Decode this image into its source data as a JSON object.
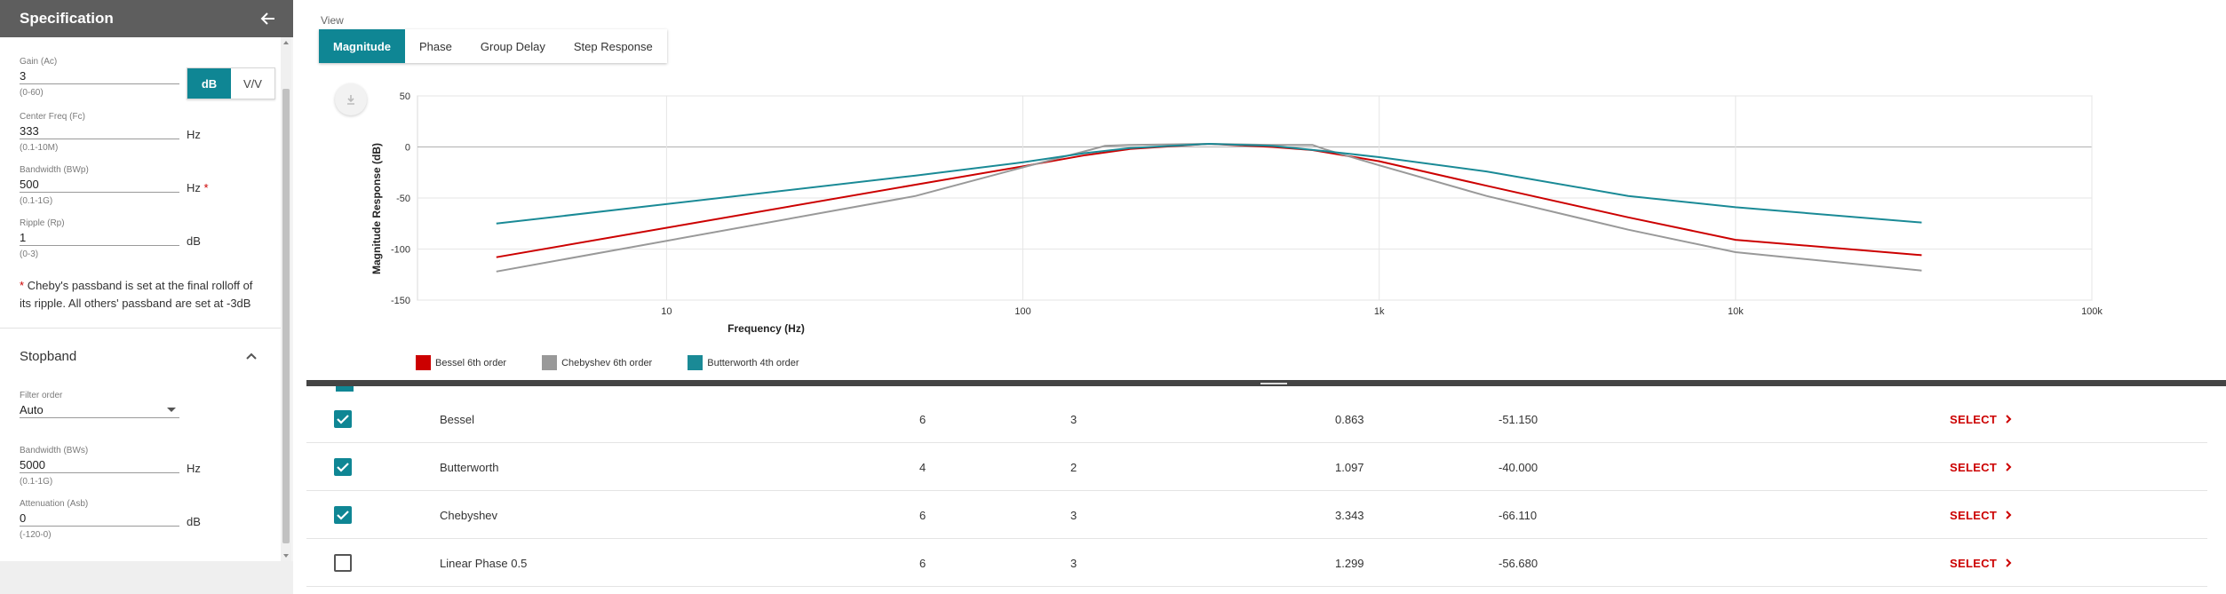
{
  "panel": {
    "title": "Specification"
  },
  "passband": {
    "gain": {
      "label": "Gain (Ac)",
      "value": "3",
      "hint": "(0-60)"
    },
    "unit_toggle": {
      "db_label": "dB",
      "vv_label": "V/V",
      "selected": "dB"
    },
    "center_freq": {
      "label": "Center Freq (Fc)",
      "value": "333",
      "hint": "(0.1-10M)",
      "unit": "Hz"
    },
    "bandwidth": {
      "label": "Bandwidth (BWp)",
      "value": "500",
      "hint": "(0.1-1G)",
      "unit": "Hz",
      "required_mark": "*"
    },
    "ripple": {
      "label": "Ripple (Rp)",
      "value": "1",
      "hint": "(0-3)",
      "unit": "dB"
    },
    "note_mark": "*",
    "note_text": "Cheby's passband is set at the final rolloff of its ripple. All others' passband are set at -3dB"
  },
  "stopband": {
    "title": "Stopband",
    "filter_order": {
      "label": "Filter order",
      "value": "Auto"
    },
    "bandwidth": {
      "label": "Bandwidth (BWs)",
      "value": "5000",
      "hint": "(0.1-1G)",
      "unit": "Hz"
    },
    "attenuation": {
      "label": "Attenuation (Asb)",
      "value": "0",
      "hint": "(-120-0)",
      "unit": "dB"
    }
  },
  "view": {
    "label": "View",
    "tabs": [
      "Magnitude",
      "Phase",
      "Group Delay",
      "Step Response"
    ],
    "active_tab": "Magnitude"
  },
  "chart_data": {
    "type": "line",
    "xlabel": "Frequency (Hz)",
    "ylabel": "Magnitude Response (dB)",
    "x_scale": "log",
    "xlim": [
      2,
      100000
    ],
    "ylim": [
      -150,
      50
    ],
    "x_ticks": [
      {
        "value": 10,
        "label": "10"
      },
      {
        "value": 100,
        "label": "100"
      },
      {
        "value": 1000,
        "label": "1k"
      },
      {
        "value": 10000,
        "label": "10k"
      },
      {
        "value": 100000,
        "label": "100k"
      }
    ],
    "y_ticks": [
      50,
      0,
      -50,
      -100,
      -150
    ],
    "grid": true,
    "legend_position": "bottom-left",
    "series": [
      {
        "name": "Bessel 6th order",
        "color": "#cc0000",
        "x": [
          3.33,
          50,
          100,
          150,
          200,
          333,
          500,
          650,
          1000,
          2000,
          5000,
          10000,
          33300
        ],
        "y": [
          -108,
          -37,
          -19,
          -8,
          -2,
          3,
          0,
          -3,
          -14,
          -38,
          -69,
          -91,
          -106
        ]
      },
      {
        "name": "Chebyshev 6th order",
        "color": "#999999",
        "x": [
          3.33,
          50,
          100,
          150,
          170,
          200,
          333,
          500,
          650,
          700,
          1000,
          2000,
          5000,
          10000,
          33300
        ],
        "y": [
          -122,
          -48,
          -20,
          -4,
          1,
          2,
          3,
          2,
          2,
          -2,
          -18,
          -48,
          -81,
          -103,
          -121
        ]
      },
      {
        "name": "Butterworth 4th order",
        "color": "#1a8a96",
        "x": [
          3.33,
          50,
          100,
          150,
          200,
          333,
          500,
          700,
          1000,
          2000,
          5000,
          10000,
          33300
        ],
        "y": [
          -75,
          -28,
          -15,
          -6,
          -1,
          3,
          1,
          -4,
          -10,
          -24,
          -48,
          -59,
          -74
        ]
      }
    ]
  },
  "table": {
    "select_label": "SELECT",
    "rows": [
      {
        "checked": true,
        "name": "Bessel",
        "order": "6",
        "stages": "3",
        "q": "0.863",
        "atten": "-51.150"
      },
      {
        "checked": true,
        "name": "Butterworth",
        "order": "4",
        "stages": "2",
        "q": "1.097",
        "atten": "-40.000"
      },
      {
        "checked": true,
        "name": "Chebyshev",
        "order": "6",
        "stages": "3",
        "q": "3.343",
        "atten": "-66.110"
      },
      {
        "checked": false,
        "name": "Linear Phase 0.5",
        "order": "6",
        "stages": "3",
        "q": "1.299",
        "atten": "-56.680"
      }
    ]
  },
  "icons": {
    "back": "arrow-left-icon",
    "collapse": "chevron-up-icon",
    "download": "download-icon",
    "check": "checkmark-icon",
    "select_chevron": "chevron-right-icon"
  }
}
